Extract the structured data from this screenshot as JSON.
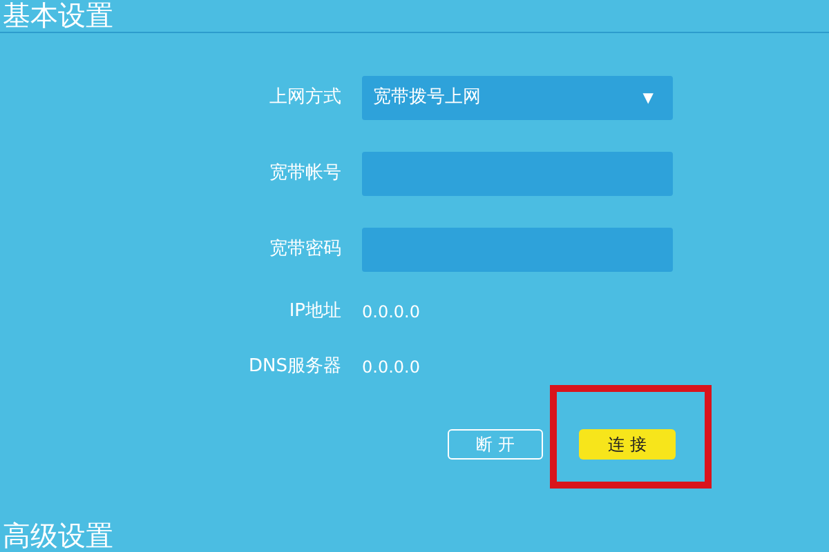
{
  "section_title": "基本设置",
  "fields": [
    {
      "kind": "select",
      "label": "上网方式",
      "value": "宽带拨号上网",
      "caret": "▼"
    },
    {
      "kind": "input",
      "label": "宽带帐号"
    },
    {
      "kind": "input",
      "label": "宽带密码"
    },
    {
      "kind": "info",
      "label": "IP地址",
      "value": "0.0.0.0"
    },
    {
      "kind": "info",
      "label": "DNS服务器",
      "value": "0.0.0.0"
    }
  ],
  "buttons": [
    {
      "label": "断 开",
      "kind": "outline"
    },
    {
      "label": "连 接",
      "kind": "primary",
      "highlighted": true
    }
  ],
  "next_section_title": "高级设置"
}
